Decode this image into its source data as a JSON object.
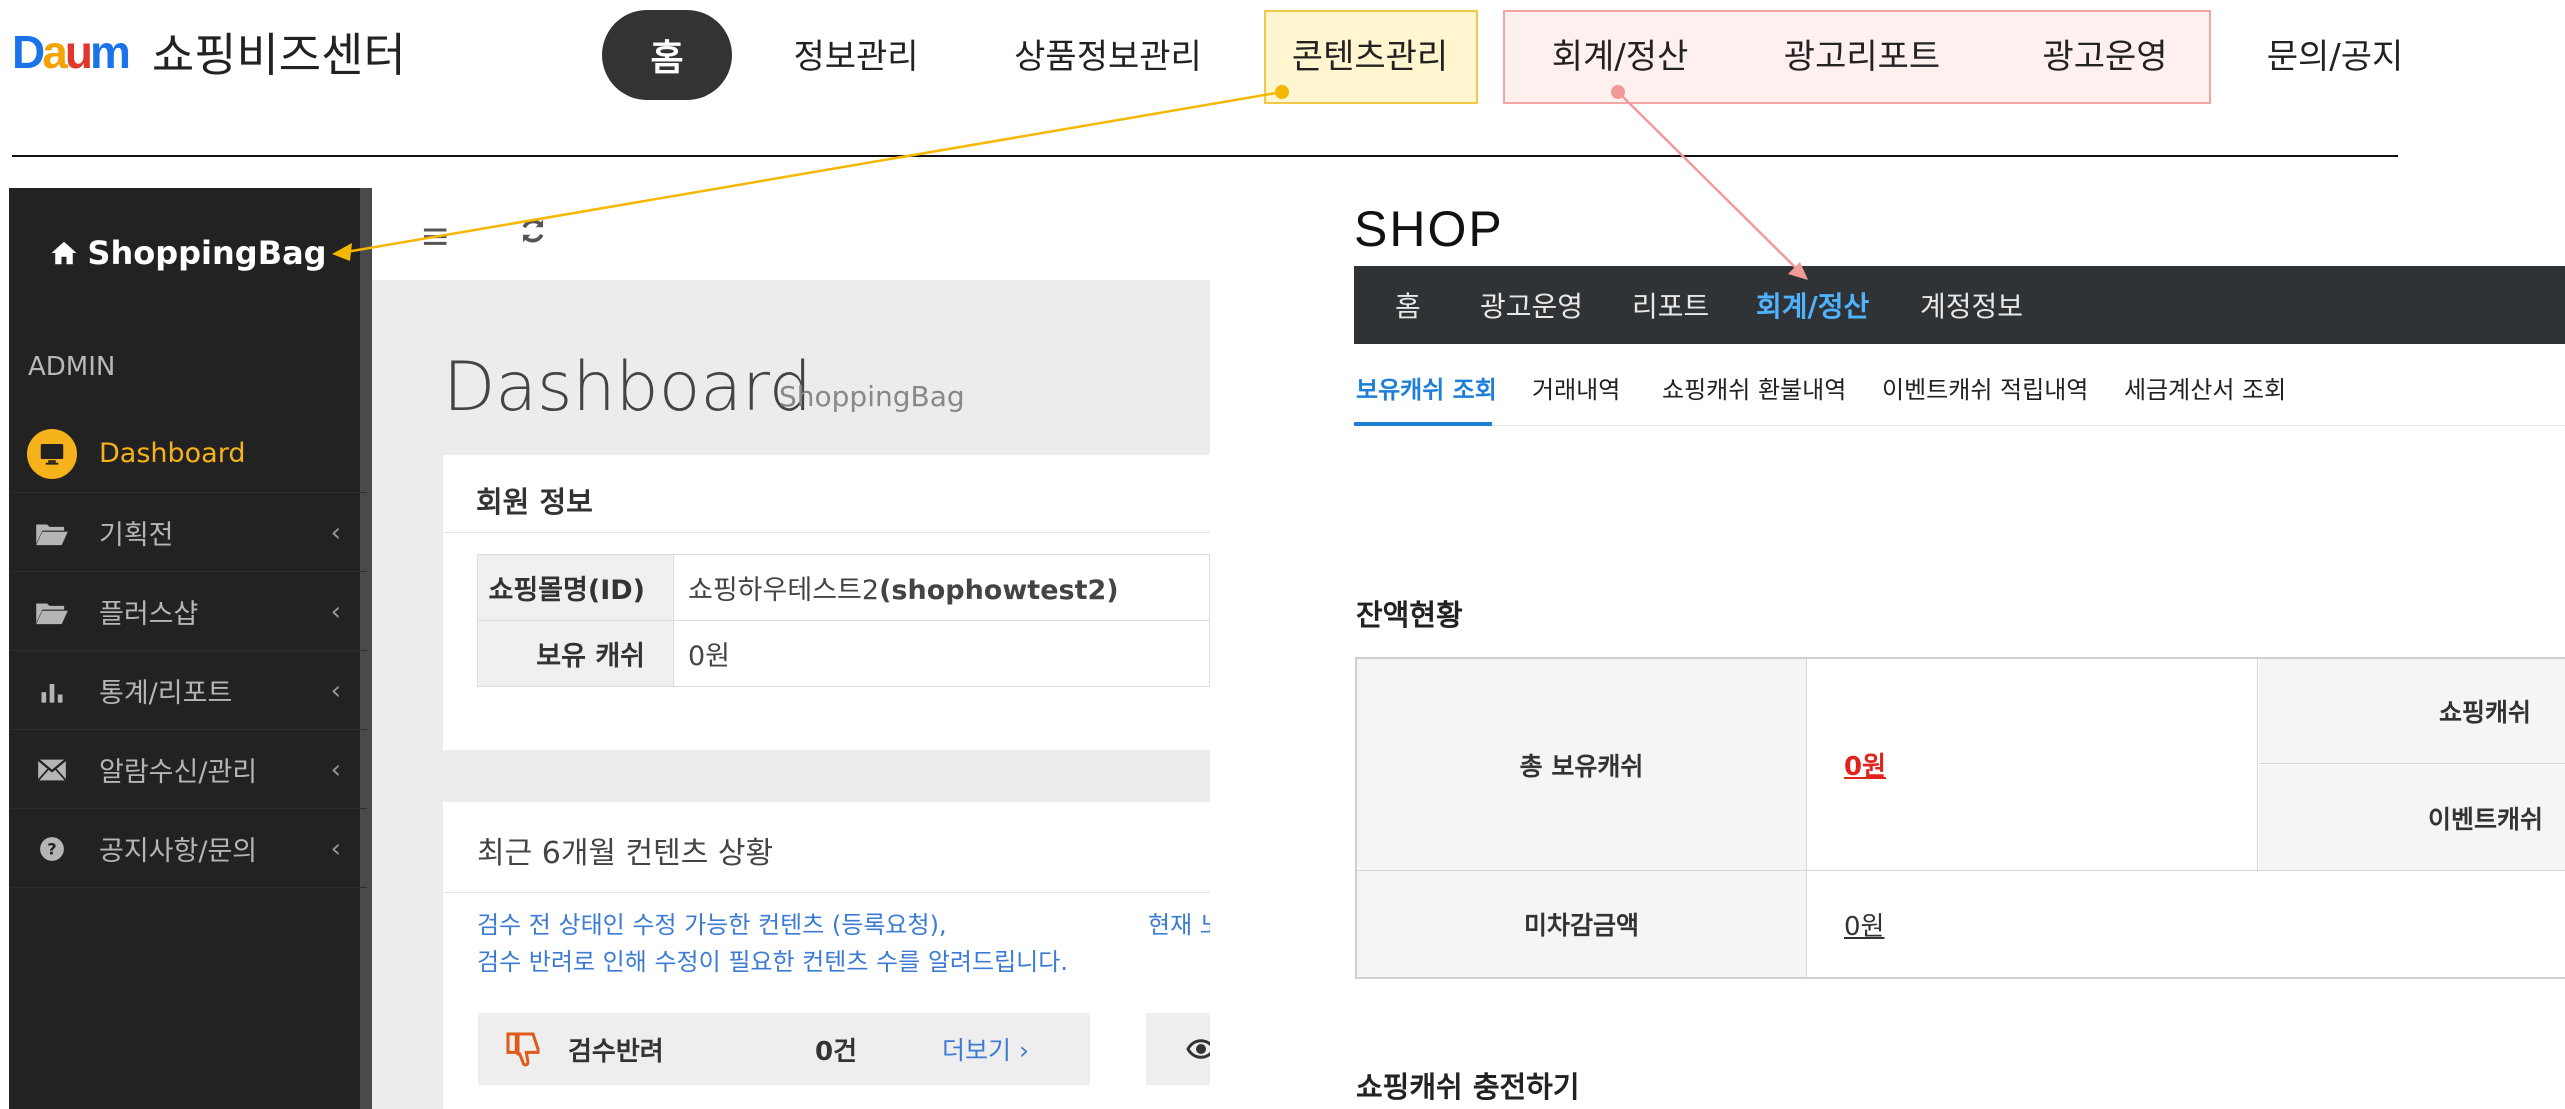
{
  "brand": {
    "logo_text": "Daum",
    "title": "쇼핑비즈센터"
  },
  "top_nav": [
    "홈",
    "정보관리",
    "상품정보관리",
    "콘텐츠관리",
    "회계/정산",
    "광고리포트",
    "광고운영",
    "문의/공지"
  ],
  "admin": {
    "brand": "ShoppingBag",
    "section_label": "ADMIN",
    "menu": [
      {
        "label": "Dashboard",
        "icon": "monitor-icon",
        "active": true
      },
      {
        "label": "기획전",
        "icon": "folder-open-icon"
      },
      {
        "label": "플러스샵",
        "icon": "folder-open-icon"
      },
      {
        "label": "통계/리포트",
        "icon": "bar-chart-icon"
      },
      {
        "label": "알람수신/관리",
        "icon": "envelope-icon"
      },
      {
        "label": "공지사항/문의",
        "icon": "question-circle-icon"
      }
    ],
    "page_title": "Dashboard",
    "page_subtitle": "ShoppingBag",
    "member_card": {
      "title": "회원 정보",
      "rows": [
        {
          "key": "쇼핑몰명(ID)",
          "value": "쇼핑하우테스트2",
          "value_bold": "(shophowtest2)"
        },
        {
          "key": "보유 캐쉬",
          "value": "0원"
        }
      ]
    },
    "recent_card": {
      "title": "최근 6개월 컨텐츠 상황",
      "desc_line1": "검수 전 상태인 수정 가능한 컨텐츠 (등록요청),",
      "desc_line2": "검수 반려로 인해 수정이 필요한 컨텐츠 수를 알려드립니다.",
      "desc_right": "현재 노출",
      "reject_label": "검수반려",
      "reject_count": "0건",
      "more_link": "더보기 ›"
    }
  },
  "shop": {
    "logo": "SHOP",
    "nav": [
      "홈",
      "광고운영",
      "리포트",
      "회계/정산",
      "계정정보"
    ],
    "nav_active": "회계/정산",
    "subtabs": [
      "보유캐쉬 조회",
      "거래내역",
      "쇼핑캐쉬 환불내역",
      "이벤트캐쉬 적립내역",
      "세금계산서 조회"
    ],
    "subtab_active": "보유캐쉬 조회",
    "balance_title": "잔액현황",
    "balance": {
      "total_label": "총 보유캐쉬",
      "total_value": "0원",
      "shopping_cash_label": "쇼핑캐쉬",
      "event_cash_label": "이벤트캐쉬",
      "undeducted_label": "미차감금액",
      "undeducted_value": "0원"
    },
    "charge_title": "쇼핑캐쉬 충전하기"
  },
  "colors": {
    "highlight_yellow": "#f1c84a",
    "highlight_red": "#f2a5a5",
    "arrow_yellow": "#f5b700",
    "arrow_red": "#f29a9a",
    "sidebar_bg": "#222222",
    "accent_orange": "#f6b21a",
    "link_blue": "#3c7bd3",
    "shop_nav_bg": "#2f3336",
    "shop_active": "#4fb3ff",
    "money_red": "#e0241b"
  }
}
